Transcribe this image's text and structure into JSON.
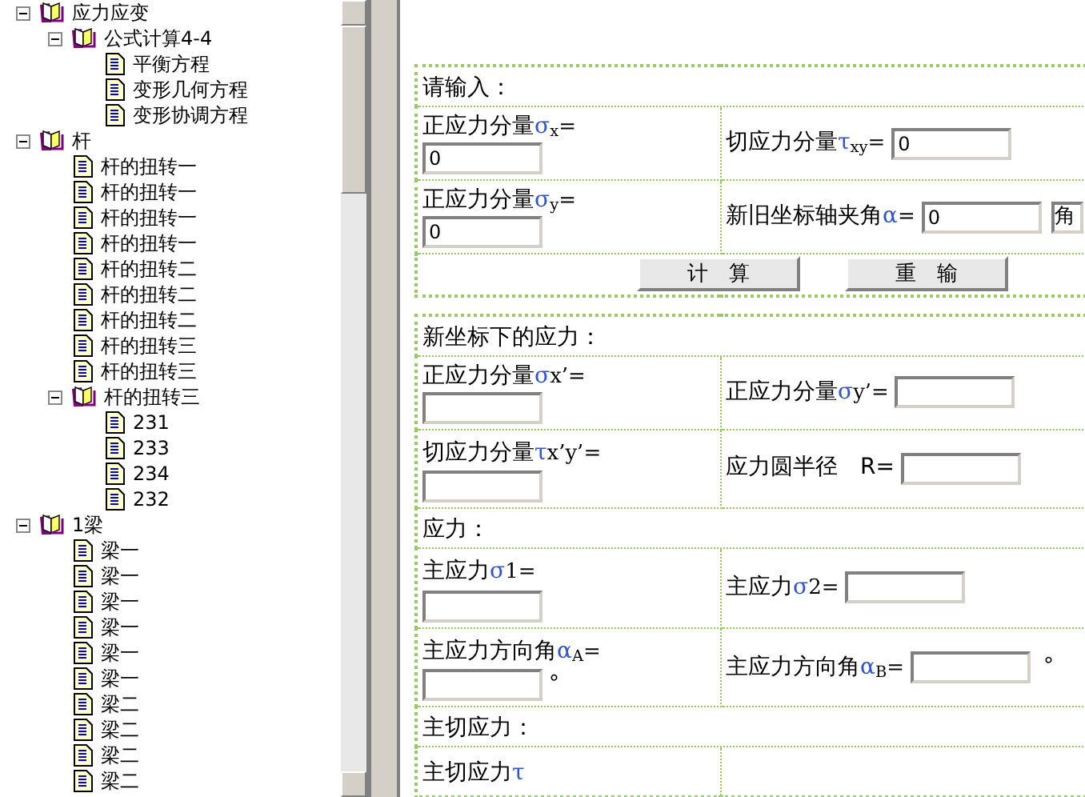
{
  "tree": [
    {
      "kind": "folder",
      "label": "应力应变",
      "expanded": true,
      "children": [
        {
          "kind": "folder",
          "label": "公式计算4-4",
          "expanded": true,
          "children": [
            {
              "kind": "doc",
              "label": "平衡方程"
            },
            {
              "kind": "doc",
              "label": "变形几何方程"
            },
            {
              "kind": "doc",
              "label": "变形协调方程"
            }
          ]
        }
      ]
    },
    {
      "kind": "folder",
      "label": "杆",
      "expanded": true,
      "children": [
        {
          "kind": "doc",
          "label": "杆的扭转一"
        },
        {
          "kind": "doc",
          "label": "杆的扭转一"
        },
        {
          "kind": "doc",
          "label": "杆的扭转一"
        },
        {
          "kind": "doc",
          "label": "杆的扭转一"
        },
        {
          "kind": "doc",
          "label": "杆的扭转二"
        },
        {
          "kind": "doc",
          "label": "杆的扭转二"
        },
        {
          "kind": "doc",
          "label": "杆的扭转二"
        },
        {
          "kind": "doc",
          "label": "杆的扭转三"
        },
        {
          "kind": "doc",
          "label": "杆的扭转三"
        },
        {
          "kind": "folder",
          "label": "杆的扭转三",
          "expanded": true,
          "children": [
            {
              "kind": "doc",
              "label": "231"
            },
            {
              "kind": "doc",
              "label": "233"
            },
            {
              "kind": "doc",
              "label": "234"
            },
            {
              "kind": "doc",
              "label": "232"
            }
          ]
        }
      ]
    },
    {
      "kind": "folder",
      "label": "1梁",
      "expanded": true,
      "children": [
        {
          "kind": "doc",
          "label": "梁一"
        },
        {
          "kind": "doc",
          "label": "梁一"
        },
        {
          "kind": "doc",
          "label": "梁一"
        },
        {
          "kind": "doc",
          "label": "梁一"
        },
        {
          "kind": "doc",
          "label": "梁一"
        },
        {
          "kind": "doc",
          "label": "梁一"
        },
        {
          "kind": "doc",
          "label": "梁二"
        },
        {
          "kind": "doc",
          "label": "梁二"
        },
        {
          "kind": "doc",
          "label": "梁二"
        },
        {
          "kind": "doc",
          "label": "梁二"
        }
      ]
    }
  ],
  "tables": [
    {
      "rows": [
        {
          "kind": "header",
          "text": "请输入："
        },
        {
          "kind": "pair",
          "cells": [
            {
              "kind": "stacked",
              "label": "正应力分量",
              "symbol": "σ",
              "rest": "$_{x}$=",
              "value": "0"
            },
            {
              "kind": "inline",
              "label": "切应力分量",
              "symbol": "τ",
              "rest": "$_{xy}$=",
              "value": "0"
            }
          ]
        },
        {
          "kind": "pair",
          "cells": [
            {
              "kind": "stacked",
              "label": "正应力分量",
              "symbol": "σ",
              "rest": "$_{y}$=",
              "value": "0"
            },
            {
              "kind": "inline",
              "label": "新旧坐标轴夹角",
              "symbol": "α",
              "rest": "=",
              "value": "0",
              "select": "角"
            }
          ]
        },
        {
          "kind": "buttons",
          "buttons": [
            "计　算",
            "重　输"
          ]
        }
      ]
    },
    {
      "rows": [
        {
          "kind": "header",
          "text": "新坐标下的应力："
        },
        {
          "kind": "pair",
          "cells": [
            {
              "kind": "stacked",
              "label": "正应力分量",
              "symbol": "σ",
              "rest": "x’="
            },
            {
              "kind": "inline",
              "label": "正应力分量",
              "symbol": "σ",
              "rest": "y’="
            }
          ]
        },
        {
          "kind": "pair",
          "cells": [
            {
              "kind": "flow",
              "label": "切应力分量",
              "symbol": "τ",
              "rest": "x’y’="
            },
            {
              "kind": "inline",
              "label": "应力圆半径　R="
            }
          ]
        },
        {
          "kind": "header",
          "text": "应力："
        },
        {
          "kind": "pair",
          "cells": [
            {
              "kind": "flow",
              "label": "主应力",
              "symbol": "σ",
              "rest": "1="
            },
            {
              "kind": "inline",
              "label": "主应力",
              "symbol": "σ",
              "rest": "2="
            }
          ]
        },
        {
          "kind": "pair",
          "cells": [
            {
              "kind": "flow",
              "label": "主应力方向角",
              "symbol": "α",
              "rest": "$_{A}$=",
              "unit": "°"
            },
            {
              "kind": "inline",
              "label": "主应力方向角",
              "symbol": "α",
              "rest": "$_{B}$=",
              "unit": "°"
            }
          ]
        },
        {
          "kind": "header",
          "text": "主切应力："
        },
        {
          "kind": "cut",
          "cells": [
            {
              "kind": "label",
              "label": "主切应力",
              "symbol": "τ"
            },
            {
              "kind": "empty"
            }
          ]
        }
      ]
    }
  ]
}
